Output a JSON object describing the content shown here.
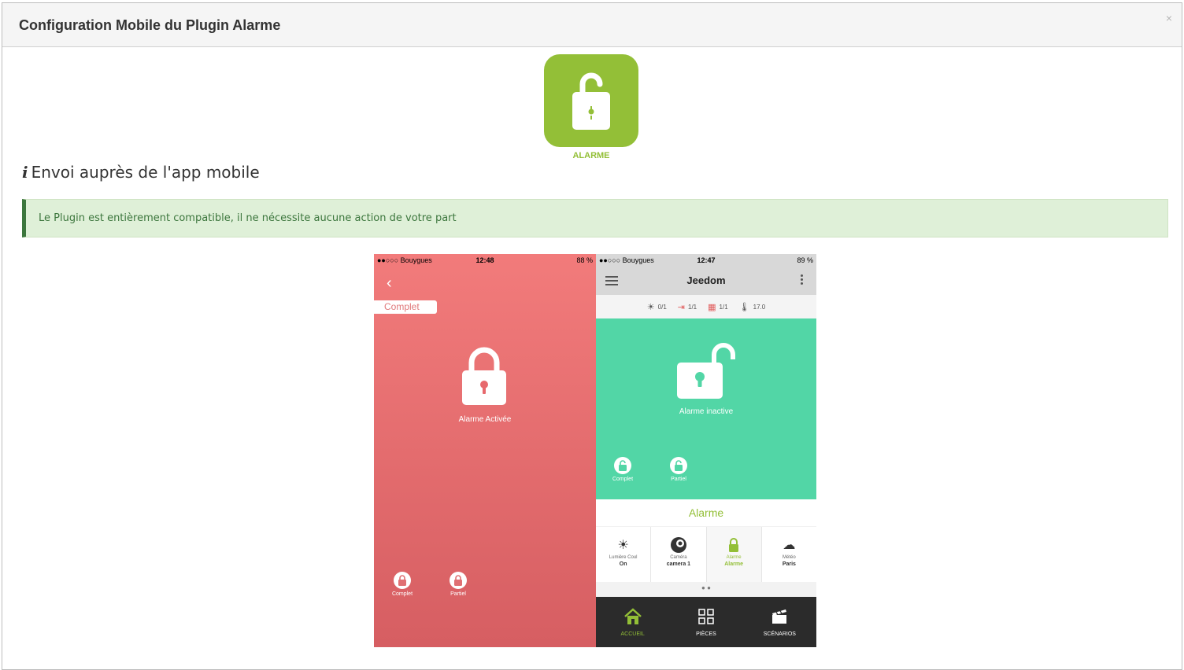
{
  "modal": {
    "title": "Configuration Mobile du Plugin Alarme",
    "close_label": "×"
  },
  "app_icon": {
    "name": "ALARME",
    "color": "#93bf37"
  },
  "section": {
    "info_icon": "i",
    "title": "Envoi auprès de l'app mobile"
  },
  "alert": {
    "text": "Le Plugin est entièrement compatible, il ne nécessite aucune action de votre part",
    "bg_color": "#dff0d8",
    "text_color": "#3c763d"
  },
  "phone_left": {
    "status": {
      "carrier": "●●○○○ Bouygues",
      "time": "12:48",
      "battery": "88 %"
    },
    "back_icon": "‹",
    "mode_tag": "Complet",
    "state_label": "Alarme Activée",
    "actions": [
      {
        "label": "Complet"
      },
      {
        "label": "Partiel"
      }
    ],
    "bg_color": "#ef7575"
  },
  "phone_right": {
    "status": {
      "carrier": "●●○○○ Bouygues",
      "time": "12:47",
      "battery": "89 %"
    },
    "app_title": "Jeedom",
    "summary": [
      {
        "icon": "light-icon",
        "glyph": "☀",
        "value": "0/1"
      },
      {
        "icon": "door-icon",
        "glyph": "⇥",
        "value": "1/1"
      },
      {
        "icon": "window-icon",
        "glyph": "▦",
        "value": "1/1"
      },
      {
        "icon": "thermometer-icon",
        "glyph": "🌡",
        "value": "17.0"
      }
    ],
    "state_label": "Alarme inactive",
    "actions": [
      {
        "label": "Complet"
      },
      {
        "label": "Partiel"
      }
    ],
    "section_title": "Alarme",
    "tiles": [
      {
        "name": "Lumière Coul",
        "value": "On",
        "icon": "bulb-icon",
        "glyph": "☀"
      },
      {
        "name": "Caméra",
        "value": "camera 1",
        "icon": "camera-icon",
        "glyph": "◐"
      },
      {
        "name": "Alarme",
        "value": "Alarme",
        "icon": "lock-icon",
        "glyph": "🔒"
      },
      {
        "name": "Météo",
        "value": "Paris",
        "icon": "cloud-icon",
        "glyph": "☁"
      }
    ],
    "dots": "● ●",
    "tabs": [
      {
        "label": "ACCUEIL",
        "icon": "home-icon"
      },
      {
        "label": "PIÈCES",
        "icon": "grid-icon"
      },
      {
        "label": "SCÉNARIOS",
        "icon": "clapper-icon"
      }
    ],
    "panel_color": "#52d6a6",
    "accent_color": "#93bf37"
  }
}
